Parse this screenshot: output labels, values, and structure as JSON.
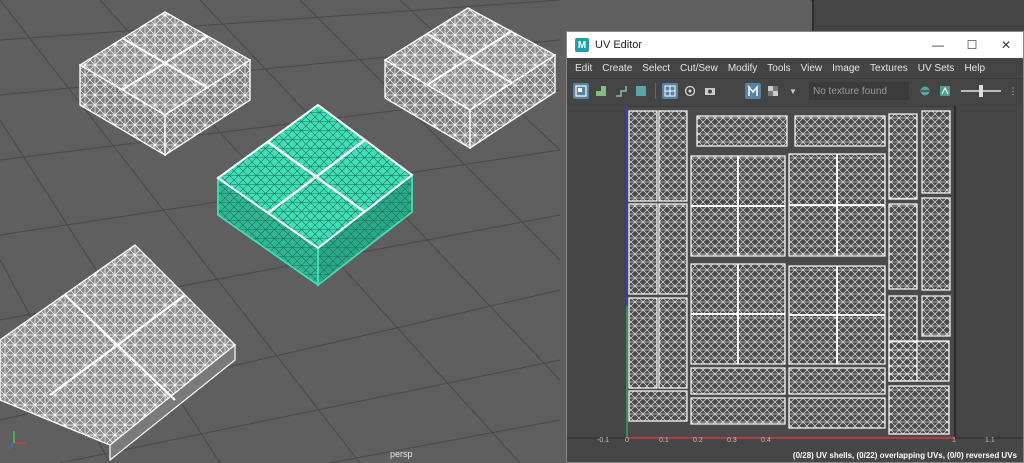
{
  "viewport": {
    "camera_label": "persp"
  },
  "uv_editor": {
    "title": "UV Editor",
    "logo": "M",
    "window_buttons": [
      "—",
      "☐",
      "✕"
    ],
    "menu": [
      "Edit",
      "Create",
      "Select",
      "Cut/Sew",
      "Modify",
      "Tools",
      "View",
      "Image",
      "Textures",
      "UV Sets",
      "Help"
    ],
    "texture_field": "No texture found",
    "status": "(0/28) UV shells, (0/22) overlapping UVs, (0/0) reversed UVs",
    "axis_ticks": [
      "-0.1",
      "0",
      "0.1",
      "0.2",
      "0.3",
      "0.4",
      "1",
      "1.1"
    ],
    "toolbar_icons": [
      "uv-selection-icon",
      "shell-icon",
      "grid-icon",
      "snap-icon",
      "checker-icon",
      "pivot-icon",
      "dim-icon",
      "camera-icon",
      "display-icon",
      "checker-toggle-icon",
      "dropdown-icon",
      "texture-icon",
      "exposure-icon",
      "gamma-icon"
    ]
  },
  "colors": {
    "viewport_bg": "#5f5f5f",
    "selected_mesh": "#3fe0b8",
    "wire": "#ffffff",
    "uv_bg": "#464646",
    "u_axis": "#d23a3a",
    "v_axis": "#3a3ad2",
    "uv_grid_line": "#2c2c2c"
  }
}
